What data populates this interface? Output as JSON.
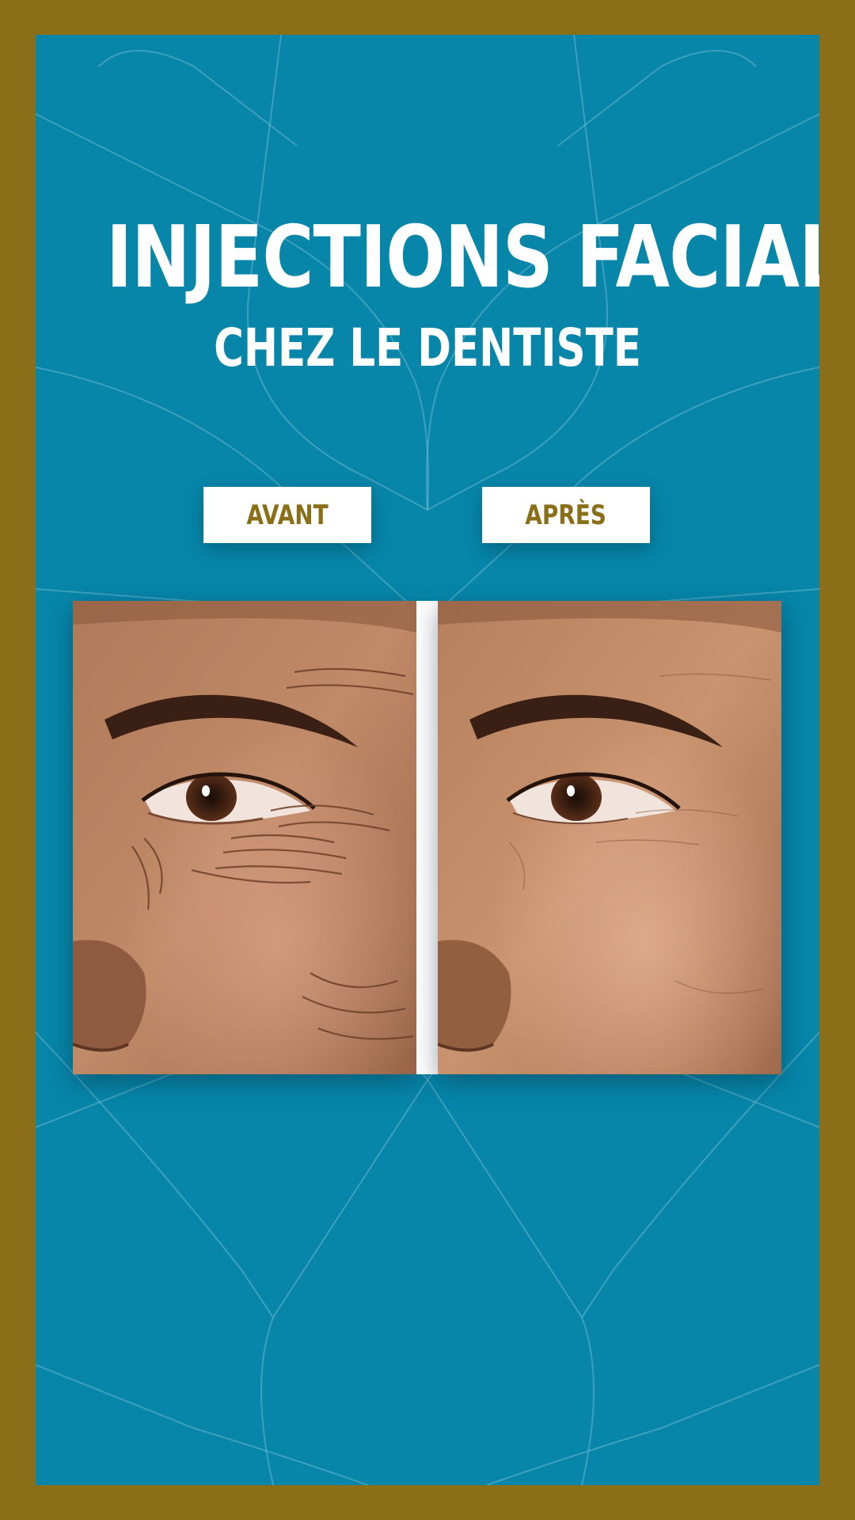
{
  "colors": {
    "frame": "#8a6f18",
    "panel": "#0786a9",
    "title": "#ffffff",
    "label_text": "#8a6f18",
    "label_bg": "#ffffff"
  },
  "header": {
    "title": "INJECTIONS FACIALES",
    "subtitle": "CHEZ LE DENTISTE"
  },
  "comparison": {
    "before_label": "AVANT",
    "after_label": "APRÈS"
  }
}
